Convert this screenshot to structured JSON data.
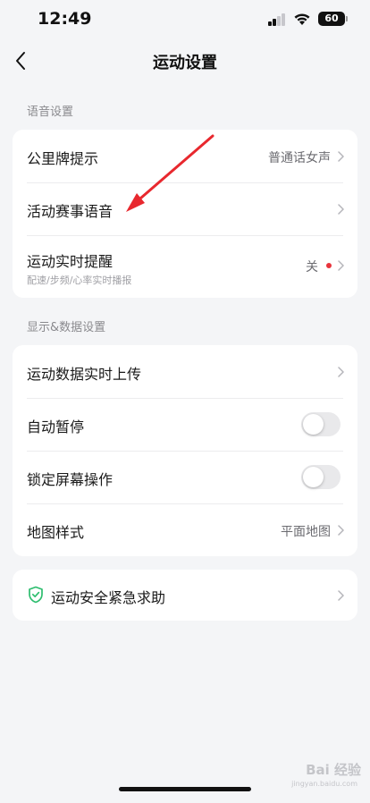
{
  "status_bar": {
    "time": "12:49",
    "battery": "60"
  },
  "nav": {
    "title": "运动设置",
    "back_icon": "chevron-left-icon"
  },
  "voice_section": {
    "header": "语音设置",
    "rows": [
      {
        "label": "公里牌提示",
        "value": "普通话女声"
      },
      {
        "label": "活动赛事语音",
        "value": ""
      },
      {
        "label": "运动实时提醒",
        "sublabel": "配速/步频/心率实时播报",
        "value": "关"
      }
    ]
  },
  "data_section": {
    "header": "显示&数据设置",
    "rows": [
      {
        "label": "运动数据实时上传"
      },
      {
        "label": "自动暂停",
        "toggle": false
      },
      {
        "label": "锁定屏幕操作",
        "toggle": false
      },
      {
        "label": "地图样式",
        "value": "平面地图"
      }
    ]
  },
  "safety": {
    "label": "运动安全紧急求助",
    "icon": "shield-check-icon",
    "icon_color": "#2dbd6e"
  },
  "colors": {
    "accent_red": "#e8343c",
    "background": "#f4f5f7"
  },
  "watermark": {
    "text": "Bai 经验",
    "sub": "jingyan.baidu.com"
  }
}
